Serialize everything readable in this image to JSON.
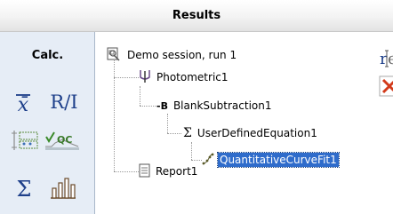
{
  "header": {
    "title": "Results"
  },
  "calc_panel": {
    "title": "Calc.",
    "tools": [
      {
        "icon": "mean-icon",
        "label": "x̄"
      },
      {
        "icon": "ratio-icon",
        "label": "R/I"
      },
      {
        "icon": "matrix-tool-icon"
      },
      {
        "icon": "qc-icon",
        "label": "√QC"
      },
      {
        "icon": "sum-icon",
        "label": "Σ"
      },
      {
        "icon": "bar-chart-icon"
      }
    ]
  },
  "tree": {
    "nodes": [
      {
        "label": "Demo session, run 1",
        "icon": "session-icon"
      },
      {
        "label": "Photometric1",
        "icon": "photometric-icon"
      },
      {
        "label": "BlankSubtraction1",
        "icon": "blank-subtraction-icon",
        "prefix": "-B"
      },
      {
        "label": "UserDefinedEquation1",
        "icon": "sigma-icon",
        "prefix": "Σ"
      },
      {
        "label": "QuantitativeCurveFit1",
        "icon": "curve-fit-icon",
        "selected": true
      },
      {
        "label": "Report1",
        "icon": "report-icon"
      }
    ]
  },
  "side_buttons": [
    {
      "icon": "rename-text-icon"
    },
    {
      "icon": "delete-icon"
    }
  ]
}
